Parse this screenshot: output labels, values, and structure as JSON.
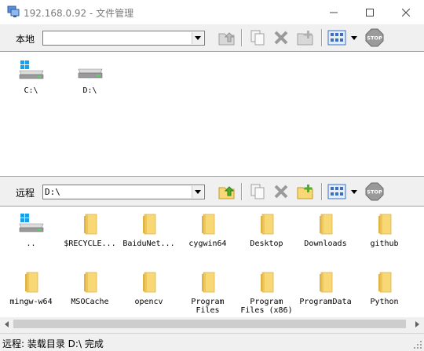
{
  "window": {
    "title": "192.168.0.92 - 文件管理"
  },
  "local": {
    "label": "本地",
    "path": "",
    "items": [
      {
        "label": "C:\\",
        "icon": "windows-drive-icon"
      },
      {
        "label": "D:\\",
        "icon": "drive-icon"
      }
    ]
  },
  "remote": {
    "label": "远程",
    "path": "D:\\",
    "items": [
      {
        "label": "..",
        "icon": "windows-drive-icon"
      },
      {
        "label": "$RECYCLE...",
        "icon": "folder-icon"
      },
      {
        "label": "BaiduNet...",
        "icon": "folder-icon"
      },
      {
        "label": "cygwin64",
        "icon": "folder-icon"
      },
      {
        "label": "Desktop",
        "icon": "folder-icon"
      },
      {
        "label": "Downloads",
        "icon": "folder-icon"
      },
      {
        "label": "github",
        "icon": "folder-icon"
      },
      {
        "label": "mingw-w64",
        "icon": "folder-icon"
      },
      {
        "label": "MSOCache",
        "icon": "folder-icon"
      },
      {
        "label": "opencv",
        "icon": "folder-icon"
      },
      {
        "label": "Program\nFiles",
        "icon": "folder-icon"
      },
      {
        "label": "Program\nFiles (x86)",
        "icon": "folder-icon"
      },
      {
        "label": "ProgramData",
        "icon": "folder-icon"
      },
      {
        "label": "Python",
        "icon": "folder-icon"
      }
    ]
  },
  "status": {
    "text": "远程: 装载目录 D:\\ 完成"
  },
  "colors": {
    "folder": "#f8d775",
    "folder_dark": "#e0b443",
    "up_arrow": "#4caf2a",
    "stop": "#8a8a8a",
    "view_blue": "#3b6fc4"
  }
}
